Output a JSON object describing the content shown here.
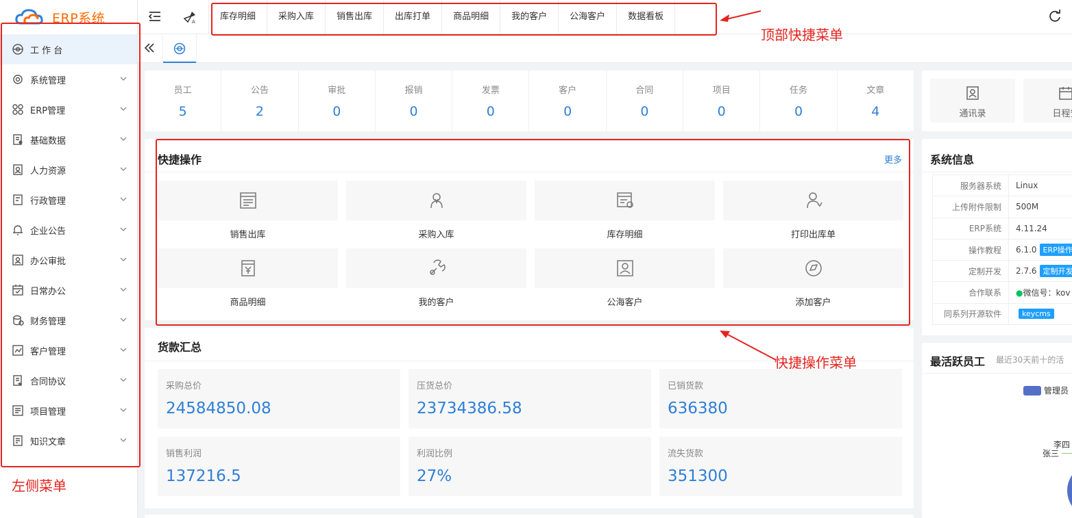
{
  "app": {
    "logo_text": "ERP系统"
  },
  "sidebar": {
    "items": [
      {
        "label": "工 作 台",
        "icon": "dashboard-icon",
        "active": true
      },
      {
        "label": "系统管理",
        "icon": "system-gear-icon"
      },
      {
        "label": "ERP管理",
        "icon": "erp-grid-icon"
      },
      {
        "label": "基础数据",
        "icon": "data-doc-icon"
      },
      {
        "label": "人力资源",
        "icon": "hr-person-icon"
      },
      {
        "label": "行政管理",
        "icon": "admin-icon"
      },
      {
        "label": "企业公告",
        "icon": "bell-icon"
      },
      {
        "label": "办公审批",
        "icon": "approval-icon"
      },
      {
        "label": "日常办公",
        "icon": "calendar-icon"
      },
      {
        "label": "财务管理",
        "icon": "finance-coins-icon"
      },
      {
        "label": "客户管理",
        "icon": "customer-icon"
      },
      {
        "label": "合同协议",
        "icon": "contract-icon"
      },
      {
        "label": "项目管理",
        "icon": "project-list-icon"
      },
      {
        "label": "知识文章",
        "icon": "article-icon"
      }
    ]
  },
  "topbar": {
    "shortcuts": [
      "库存明细",
      "采购入库",
      "销售出库",
      "出库打单",
      "商品明细",
      "我的客户",
      "公海客户",
      "数据看板"
    ]
  },
  "stats": [
    {
      "label": "员工",
      "value": "5"
    },
    {
      "label": "公告",
      "value": "2"
    },
    {
      "label": "审批",
      "value": "0"
    },
    {
      "label": "报销",
      "value": "0"
    },
    {
      "label": "发票",
      "value": "0"
    },
    {
      "label": "客户",
      "value": "0"
    },
    {
      "label": "合同",
      "value": "0"
    },
    {
      "label": "项目",
      "value": "0"
    },
    {
      "label": "任务",
      "value": "0"
    },
    {
      "label": "文章",
      "value": "4"
    }
  ],
  "quick": {
    "title": "快捷操作",
    "more": "更多",
    "items": [
      {
        "label": "销售出库",
        "icon": "sales-outbound-icon"
      },
      {
        "label": "采购入库",
        "icon": "purchase-inbound-icon"
      },
      {
        "label": "库存明细",
        "icon": "inventory-detail-icon"
      },
      {
        "label": "打印出库单",
        "icon": "print-outbound-icon"
      },
      {
        "label": "商品明细",
        "icon": "product-yen-icon"
      },
      {
        "label": "我的客户",
        "icon": "wrench-customer-icon"
      },
      {
        "label": "公海客户",
        "icon": "public-customer-icon"
      },
      {
        "label": "添加客户",
        "icon": "add-customer-icon"
      }
    ]
  },
  "goods": {
    "title": "货款汇总",
    "items": [
      {
        "label": "采购总价",
        "value": "24584850.08"
      },
      {
        "label": "压货总价",
        "value": "23734386.58"
      },
      {
        "label": "已销货款",
        "value": "636380"
      },
      {
        "label": "销售利润",
        "value": "137216.5"
      },
      {
        "label": "利润比例",
        "value": "27%"
      },
      {
        "label": "流失货款",
        "value": "351300"
      }
    ]
  },
  "right": {
    "buttons": [
      {
        "label": "通讯录",
        "icon": "contacts-icon"
      },
      {
        "label": "日程安",
        "icon": "schedule-icon"
      }
    ],
    "sysinfo": {
      "title": "系统信息",
      "rows": [
        {
          "key": "服务器系统",
          "value": "Linux"
        },
        {
          "key": "上传附件限制",
          "value": "500M"
        },
        {
          "key": "ERP系统",
          "value": "4.11.24"
        },
        {
          "key": "操作教程",
          "value": "6.1.0",
          "badge": "ERP操作"
        },
        {
          "key": "定制开发",
          "value": "2.7.6",
          "badge": "定制开发"
        },
        {
          "key": "合作联系",
          "value": "微信号：kov"
        },
        {
          "key": "同系列开源软件",
          "value": "",
          "badge": "keycms"
        }
      ]
    },
    "active": {
      "title": "最活跃员工",
      "subtitle": "最近30天前十的活",
      "legend": "管理员",
      "names": [
        "李四",
        "张三"
      ]
    }
  },
  "annotations": {
    "top": "顶部快捷菜单",
    "quick": "快捷操作菜单",
    "left": "左侧菜单"
  }
}
